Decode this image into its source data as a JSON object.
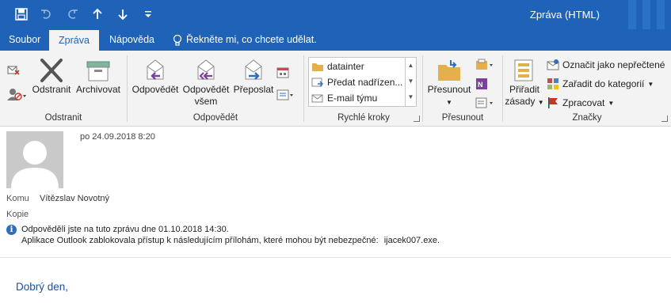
{
  "window": {
    "title": "Zpráva (HTML)"
  },
  "qat": {
    "save_icon": "save-icon",
    "undo_icon": "undo-icon",
    "redo_icon": "redo-icon",
    "up_icon": "arrow-up-icon",
    "down_icon": "arrow-down-icon",
    "customize_icon": "customize-qat-icon"
  },
  "tabs": [
    {
      "label": "Soubor"
    },
    {
      "label": "Zpráva",
      "active": true
    },
    {
      "label": "Nápověda"
    }
  ],
  "tellme": {
    "label": "Řekněte mi, co chcete udělat."
  },
  "ribbon": {
    "delete_group": {
      "label": "Odstranit",
      "delete": "Odstranit",
      "archive": "Archivovat"
    },
    "respond_group": {
      "label": "Odpovědět",
      "reply": "Odpovědět",
      "reply_all_1": "Odpovědět",
      "reply_all_2": "všem",
      "forward": "Přeposlat"
    },
    "quicksteps_group": {
      "label": "Rychlé kroky",
      "items": [
        "datainter",
        "Předat nadřízen...",
        "E-mail týmu"
      ]
    },
    "move_group": {
      "label": "Přesunout",
      "move": "Přesunout"
    },
    "tags_group": {
      "label": "Značky",
      "assign_policy_1": "Přiřadit",
      "assign_policy_2": "zásady",
      "mark_unread": "Označit jako nepřečtené",
      "categorize": "Zařadit do kategorií",
      "follow_up": "Zpracovat"
    }
  },
  "message": {
    "date": "po 24.09.2018 8:20",
    "to_label": "Komu",
    "to_value": "Vítězslav Novotný",
    "cc_label": "Kopie",
    "info_line1": "Odpověděli jste na tuto zprávu dne 01.10.2018 14:30.",
    "info_line2": "Aplikace Outlook zablokovala přístup k následujícím přílohám, které mohou být nebezpečné:",
    "attachment": "ijacek007.exe.",
    "body_greeting": "Dobrý den,"
  },
  "colors": {
    "title_bar": "#1e63b8",
    "ribbon_bg": "#f3f3f3",
    "accent_purple": "#7b3fa0",
    "accent_blue": "#2f6ebd"
  }
}
